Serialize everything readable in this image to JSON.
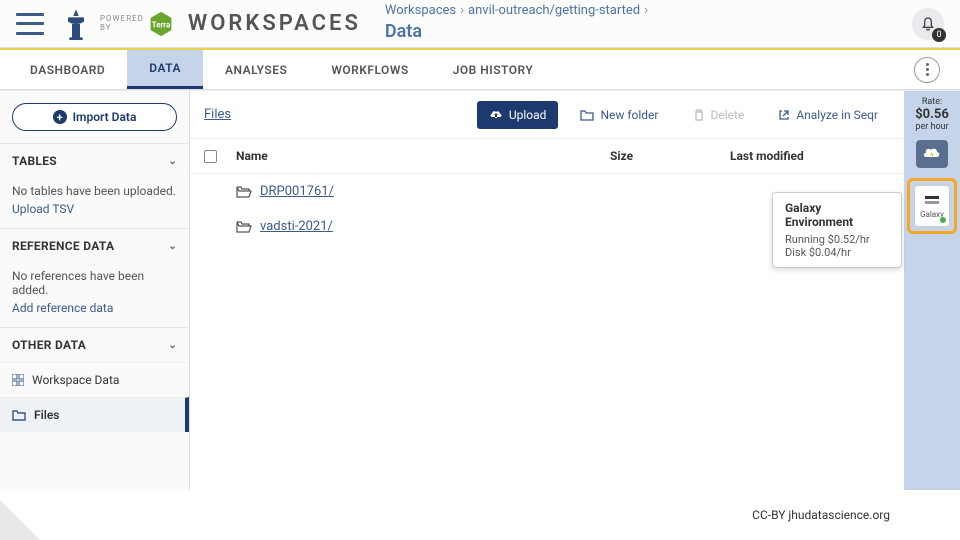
{
  "header": {
    "powered_label": "POWERED\nBY",
    "title": "WORKSPACES",
    "breadcrumb": {
      "root": "Workspaces",
      "project": "anvil-outreach/getting-started",
      "current": "Data"
    },
    "notify_count": "0"
  },
  "tabs": [
    "DASHBOARD",
    "DATA",
    "ANALYSES",
    "WORKFLOWS",
    "JOB HISTORY"
  ],
  "sidebar": {
    "import_label": "Import Data",
    "sections": {
      "tables": {
        "heading": "TABLES",
        "empty": "No tables have been uploaded.",
        "action": "Upload TSV"
      },
      "reference": {
        "heading": "REFERENCE DATA",
        "empty": "No references have been added.",
        "action": "Add reference data"
      },
      "other": {
        "heading": "OTHER DATA",
        "items": [
          "Workspace Data",
          "Files"
        ]
      }
    }
  },
  "toolbar": {
    "files_link": "Files",
    "upload": "Upload",
    "new_folder": "New folder",
    "delete": "Delete",
    "analyze": "Analyze in Seqr"
  },
  "table": {
    "cols": {
      "name": "Name",
      "size": "Size",
      "modified": "Last modified"
    },
    "rows": [
      {
        "name": "DRP001761/"
      },
      {
        "name": "vadsti-2021/"
      }
    ]
  },
  "rate_panel": {
    "label": "Rate:",
    "value": "$0.56",
    "per": "per hour",
    "galaxy_label": "Galaxy"
  },
  "tooltip": {
    "title": "Galaxy Environment",
    "line1": "Running $0.52/hr",
    "line2": "Disk $0.04/hr"
  },
  "footer": "CC-BY  jhudatascience.org"
}
